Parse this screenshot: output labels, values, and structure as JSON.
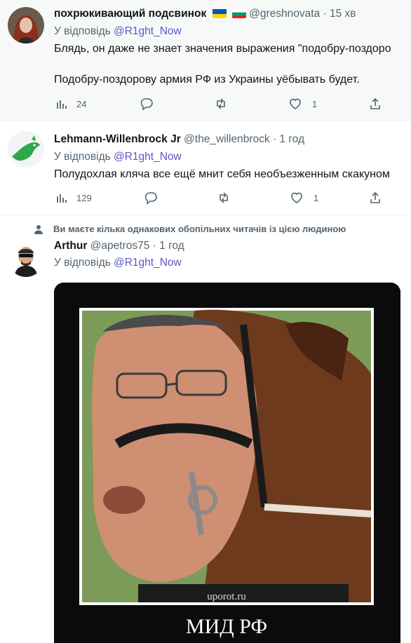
{
  "tweets": [
    {
      "name": "похрюкивающий подсвинок",
      "handle": "@greshnovata",
      "time": "15 хв",
      "reply_prefix": "У відповідь",
      "reply_to": "@R1ght_Now",
      "line1": "Блядь, он даже не знает значения выражения \"подобру-поздоро",
      "line2": "Подобру-поздорову армия РФ из Украины уёбывать будет.",
      "replies": "24",
      "likes": "1"
    },
    {
      "name": "Lehmann-Willenbrock Jr",
      "handle": "@the_willenbrock",
      "time": "1 год",
      "reply_prefix": "У відповідь",
      "reply_to": "@R1ght_Now",
      "line1": "Полудохлая кляча все ещё мнит себя необъезженным скакуном",
      "replies": "129",
      "likes": "1"
    },
    {
      "social_context": "Ви маєте кілька однакових обопільних читачів із цією людиною",
      "name": "Arthur",
      "handle": "@apetros75",
      "time": "1 год",
      "reply_prefix": "У відповідь",
      "reply_to": "@R1ght_Now",
      "image": {
        "watermark": "uporot.ru",
        "caption": "МИД РФ"
      }
    }
  ],
  "icons": {
    "stats": "bar-chart-icon",
    "reply": "reply-icon",
    "retweet": "retweet-icon",
    "like": "heart-icon",
    "share": "share-icon",
    "social": "person-icon"
  },
  "colors": {
    "accent": "#1d9bf0",
    "muted": "#536471",
    "highlight_bg": "#f7f9f9"
  }
}
